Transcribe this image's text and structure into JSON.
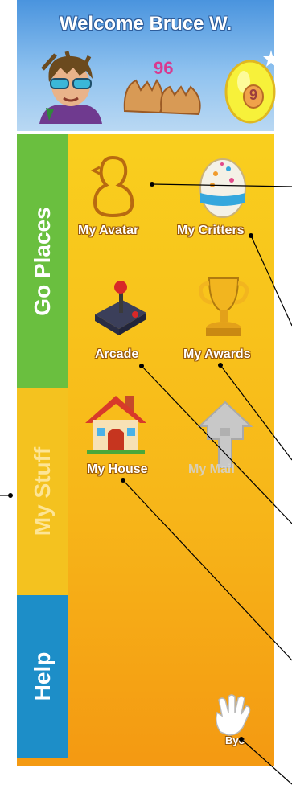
{
  "header": {
    "welcome": "Welcome Bruce W.",
    "counter": "96",
    "egg_level": "9"
  },
  "tabs": [
    {
      "label": "Go Places",
      "color": "#6abf3f"
    },
    {
      "label": "My Stuff",
      "color": "#f4c21f"
    },
    {
      "label": "Help",
      "color": "#1d8ec8"
    }
  ],
  "items": {
    "my_avatar": "My Avatar",
    "my_critters": "My Critters",
    "arcade": "Arcade",
    "my_awards": "My Awards",
    "my_house": "My House",
    "my_mail": "My Mail",
    "bye": "Bye"
  },
  "icons": [
    "avatar-character-icon",
    "eggshell-icon",
    "golden-egg-icon",
    "chick-outline-icon",
    "spotted-egg-icon",
    "joystick-icon",
    "trophy-icon",
    "house-icon",
    "mailbox-icon",
    "waving-hand-icon"
  ]
}
